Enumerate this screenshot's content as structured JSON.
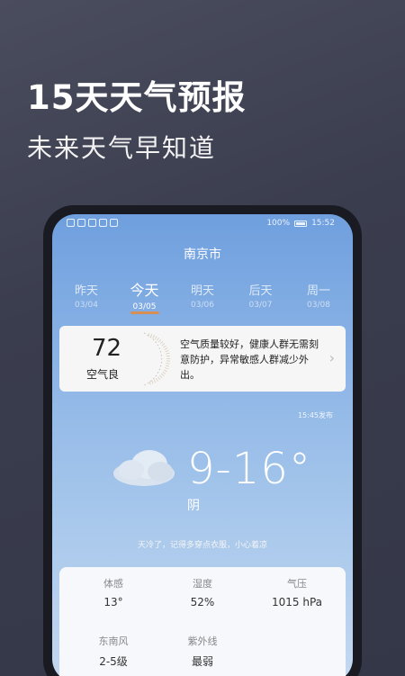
{
  "promo": {
    "title": "15天天气预报",
    "subtitle": "未来天气早知道"
  },
  "statusbar": {
    "battery": "100%",
    "time": "15:52"
  },
  "city": "南京市",
  "days": [
    {
      "name": "昨天",
      "date": "03/04",
      "active": false
    },
    {
      "name": "今天",
      "date": "03/05",
      "active": true
    },
    {
      "name": "明天",
      "date": "03/06",
      "active": false
    },
    {
      "name": "后天",
      "date": "03/07",
      "active": false
    },
    {
      "name": "周一",
      "date": "03/08",
      "active": false
    }
  ],
  "aqi": {
    "value": "72",
    "label": "空气良",
    "description": "空气质量较好，健康人群无需刻意防护，异常敏感人群减少外出。"
  },
  "update_time": "15:45发布",
  "weather": {
    "temperature": "9-16°",
    "condition": "阴",
    "tip": "天冷了，记得多穿点衣服，小心着凉"
  },
  "details": [
    {
      "label": "体感",
      "value": "13°"
    },
    {
      "label": "湿度",
      "value": "52%"
    },
    {
      "label": "气压",
      "value": "1015 hPa"
    },
    {
      "label": "东南风",
      "value": "2-5级"
    },
    {
      "label": "紫外线",
      "value": "最弱"
    }
  ],
  "colors": {
    "accent": "#e88a3a",
    "background": "#3e4152",
    "sky_top": "#6f9fde"
  }
}
